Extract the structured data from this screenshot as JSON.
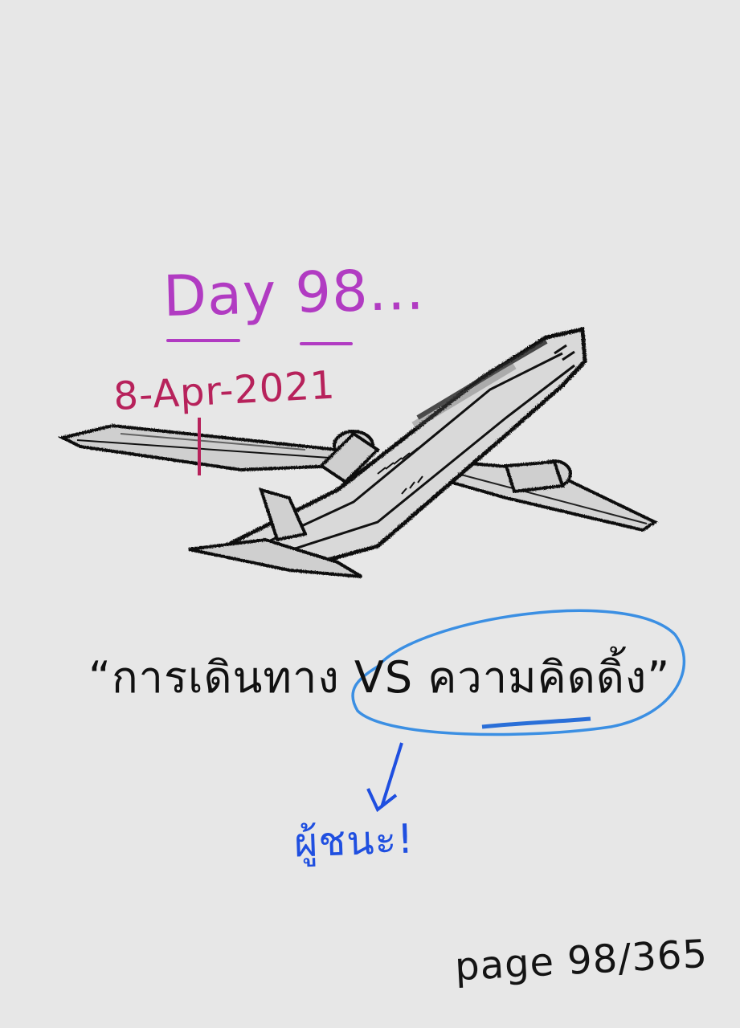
{
  "note": {
    "day_label": "Day 98...",
    "date": "8-Apr-2021",
    "quote": "“การเดินทาง  VS  ความคิดดิ้ง”",
    "winner": "ผู้ชนะ!",
    "page_label": "page 98/365"
  },
  "illustration": {
    "subject": "airplane-sketch-icon"
  },
  "colors": {
    "background": "#e7e7e7",
    "day_label": "#b13bc2",
    "date": "#b7225b",
    "quote": "#111111",
    "highlight_circle": "#3b8fe3",
    "arrow": "#1f4fe0",
    "winner": "#1f4fe0",
    "page_label": "#141414",
    "ink": "#111111"
  }
}
